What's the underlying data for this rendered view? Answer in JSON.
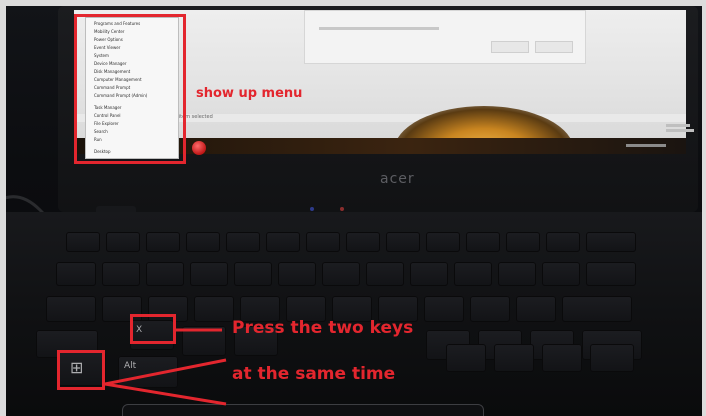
{
  "annotations": {
    "menu_label": "show up menu",
    "keys_line1": "Press the two keys",
    "keys_line2": "at the same time"
  },
  "laptop": {
    "brand": "acer",
    "x_key": "X",
    "alt_key": "Alt",
    "windows_key": "⊞"
  },
  "context_menu": {
    "items": [
      "Programs and Features",
      "Mobility Center",
      "Power Options",
      "Event Viewer",
      "System",
      "Device Manager",
      "Disk Management",
      "Computer Management",
      "Command Prompt",
      "Command Prompt (Admin)",
      "Task Manager",
      "Control Panel",
      "File Explorer",
      "Search",
      "Run",
      "Desktop"
    ]
  },
  "screen": {
    "status_text": "1 item selected"
  },
  "colors": {
    "annotation": "#e3262e",
    "screen": "#e6e6e6",
    "start_orb": "#c01616"
  }
}
